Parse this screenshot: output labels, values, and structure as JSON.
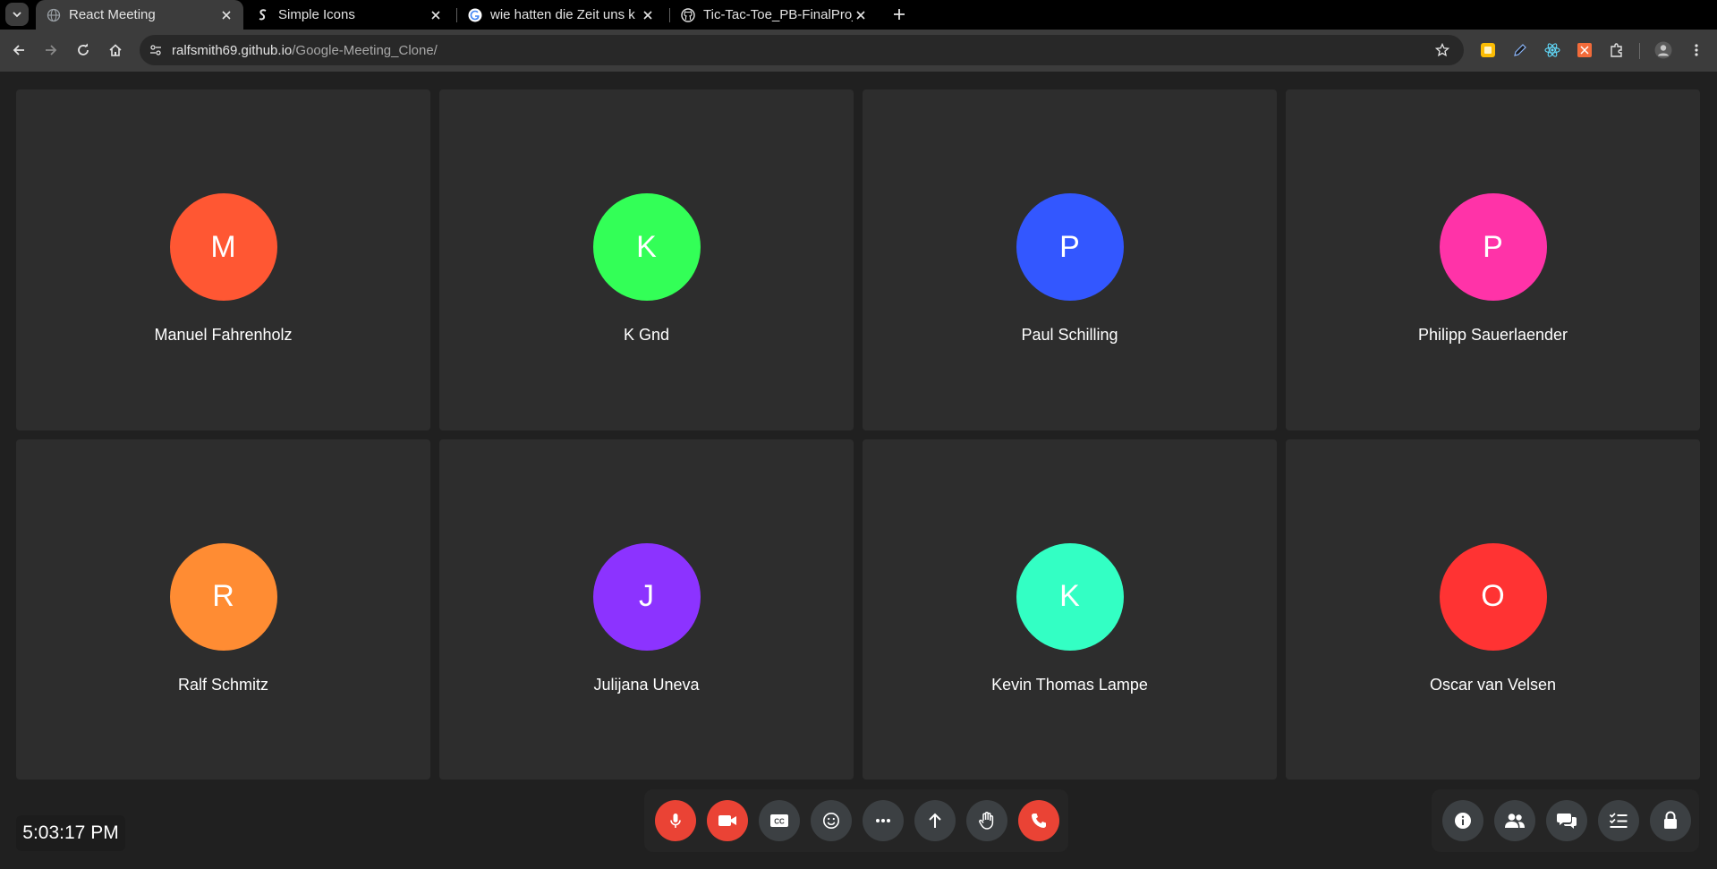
{
  "browser": {
    "tabs": [
      {
        "title": "React Meeting",
        "active": true,
        "favicon": "globe-icon"
      },
      {
        "title": "Simple Icons",
        "active": false,
        "favicon": "simple-icons-logo-icon"
      },
      {
        "title": "wie hatten die Zeit uns k",
        "active": false,
        "favicon": "google-logo-icon"
      },
      {
        "title": "Tic-Tac-Toe_PB-FinalProj",
        "active": false,
        "favicon": "github-logo-icon"
      }
    ],
    "url_host": "ralfsmith69.github.io",
    "url_path": "/Google-Meeting_Clone/"
  },
  "participants": [
    {
      "initial": "M",
      "name": "Manuel Fahrenholz",
      "color": "#ff5733"
    },
    {
      "initial": "K",
      "name": "K Gnd",
      "color": "#33ff57"
    },
    {
      "initial": "P",
      "name": "Paul Schilling",
      "color": "#3357ff"
    },
    {
      "initial": "P",
      "name": "Philipp Sauerlaender",
      "color": "#ff33a8"
    },
    {
      "initial": "R",
      "name": "Ralf Schmitz",
      "color": "#ff8c33"
    },
    {
      "initial": "J",
      "name": "Julijana Uneva",
      "color": "#8c33ff"
    },
    {
      "initial": "K",
      "name": "Kevin Thomas Lampe",
      "color": "#33ffc4"
    },
    {
      "initial": "O",
      "name": "Oscar van Velsen",
      "color": "#ff3333"
    }
  ],
  "clock": {
    "time": "5:03:17 PM"
  },
  "controls": [
    {
      "name": "microphone-icon",
      "state": "off"
    },
    {
      "name": "video-camera-icon",
      "state": "off"
    },
    {
      "name": "closed-captions-icon",
      "state": "neutral"
    },
    {
      "name": "emoji-icon",
      "state": "neutral"
    },
    {
      "name": "more-options-icon",
      "state": "neutral"
    },
    {
      "name": "present-screen-icon",
      "state": "neutral"
    },
    {
      "name": "raise-hand-icon",
      "state": "neutral"
    },
    {
      "name": "leave-call-icon",
      "state": "end"
    }
  ],
  "side_controls": [
    "info-icon",
    "people-icon",
    "chat-icon",
    "activities-icon",
    "lock-icon"
  ],
  "colors": {
    "control_red": "#ea4335",
    "control_grey": "#3c4043",
    "tile_bg": "#2d2d2d"
  }
}
